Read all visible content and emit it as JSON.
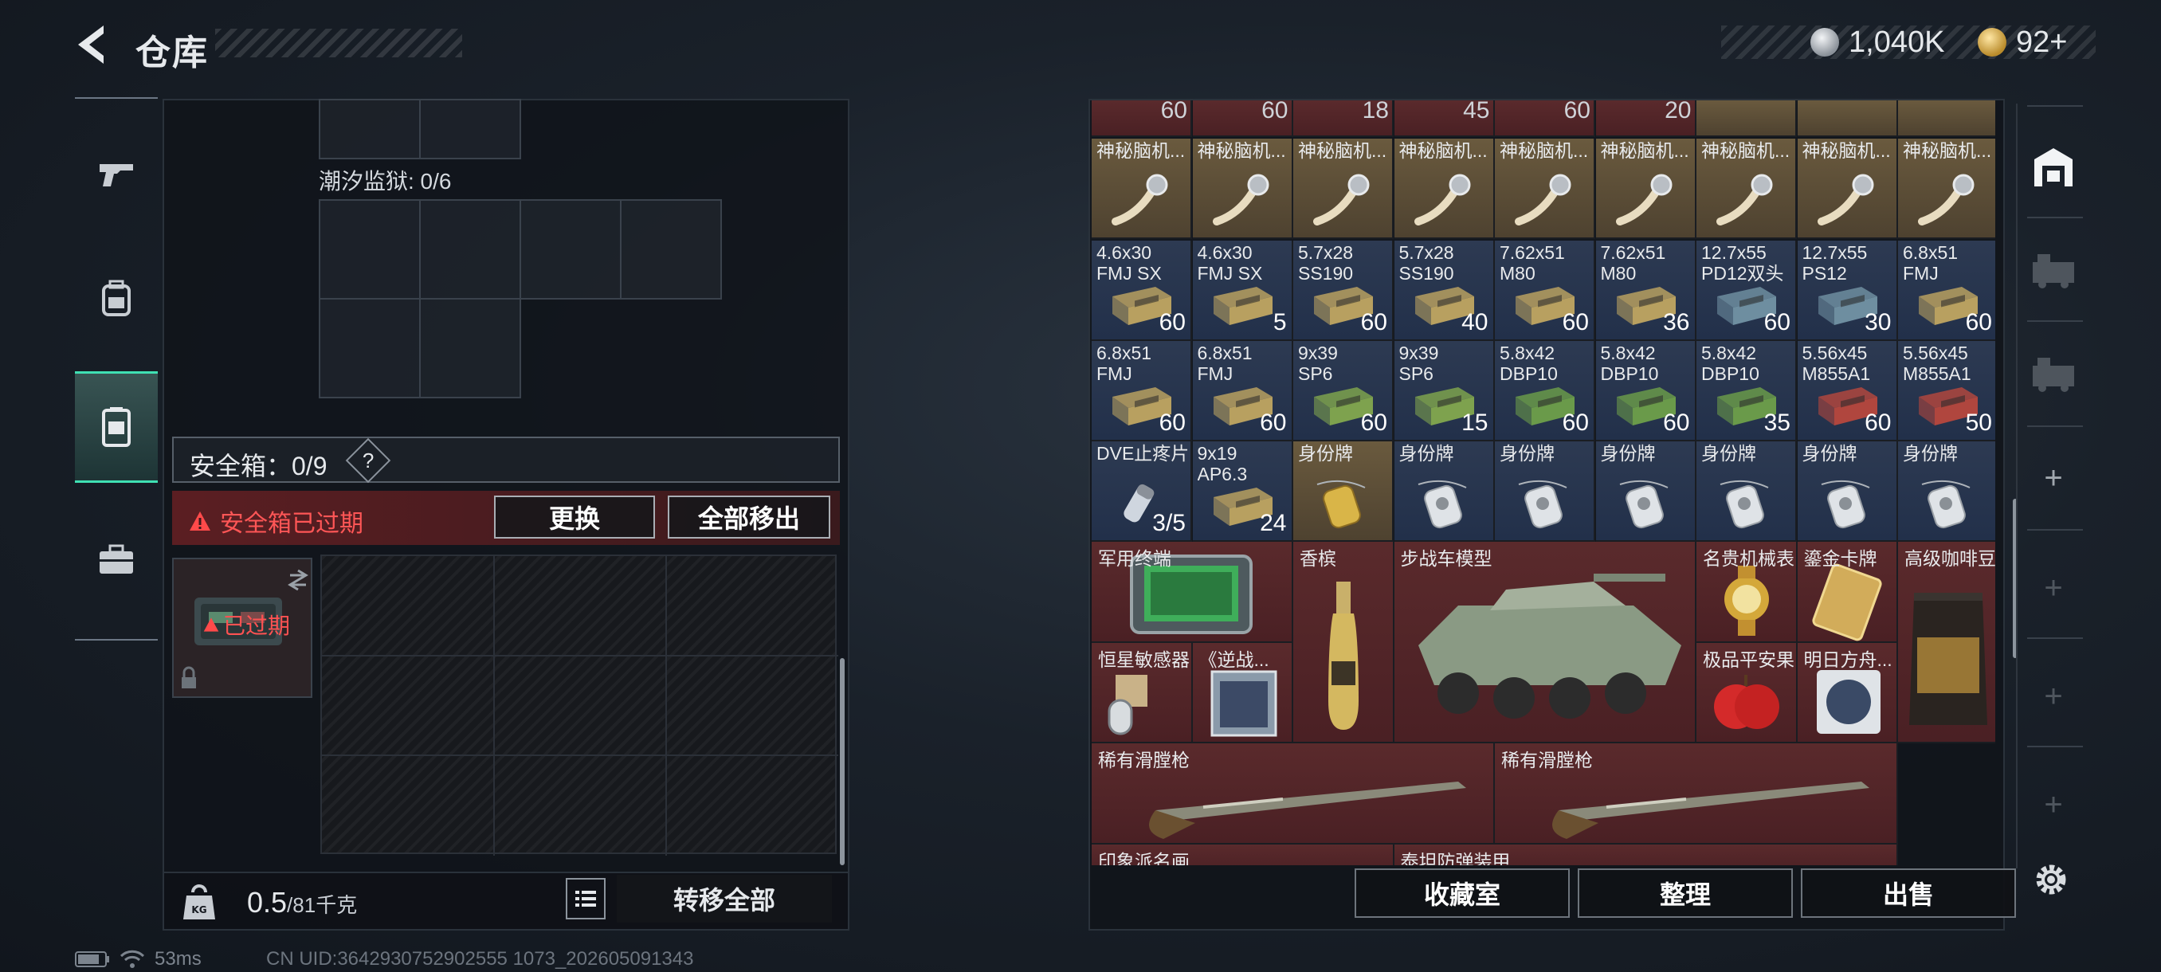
{
  "header": {
    "title": "仓库"
  },
  "currency": {
    "silver": "1,040K",
    "gold": "92+"
  },
  "left": {
    "prison_label": "潮汐监狱: 0/6",
    "safebox_label": "安全箱：0/9",
    "help": "?",
    "expired_warning": "安全箱已过期",
    "replace_btn": "更换",
    "remove_all_btn": "全部移出",
    "item_expired": "已过期",
    "weight_value": "0.5",
    "weight_max": "/81千克",
    "transfer_all": "转移全部"
  },
  "status": {
    "ping": "53ms",
    "uid": "CN UID:3642930752902555 1073_202605091343"
  },
  "inventory": {
    "top_qty": [
      "60",
      "60",
      "18",
      "45",
      "60",
      "20"
    ],
    "row1": [
      {
        "name": "神秘脑机...",
        "qty": ""
      },
      {
        "name": "神秘脑机...",
        "qty": ""
      },
      {
        "name": "神秘脑机...",
        "qty": ""
      },
      {
        "name": "神秘脑机...",
        "qty": ""
      },
      {
        "name": "神秘脑机...",
        "qty": ""
      },
      {
        "name": "神秘脑机...",
        "qty": ""
      },
      {
        "name": "神秘脑机...",
        "qty": ""
      },
      {
        "name": "神秘脑机...",
        "qty": ""
      },
      {
        "name": "神秘脑机...",
        "qty": ""
      }
    ],
    "row2": [
      {
        "name": "4.6x30",
        "sub": "FMJ SX",
        "qty": "60"
      },
      {
        "name": "4.6x30",
        "sub": "FMJ SX",
        "qty": "5"
      },
      {
        "name": "5.7x28",
        "sub": "SS190",
        "qty": "60"
      },
      {
        "name": "5.7x28",
        "sub": "SS190",
        "qty": "40"
      },
      {
        "name": "7.62x51",
        "sub": "M80",
        "qty": "60"
      },
      {
        "name": "7.62x51",
        "sub": "M80",
        "qty": "36"
      },
      {
        "name": "12.7x55",
        "sub": "PD12双头",
        "qty": "60"
      },
      {
        "name": "12.7x55",
        "sub": "PS12",
        "qty": "30"
      },
      {
        "name": "6.8x51",
        "sub": "FMJ",
        "qty": "60"
      }
    ],
    "row3": [
      {
        "name": "6.8x51",
        "sub": "FMJ",
        "qty": "60"
      },
      {
        "name": "6.8x51",
        "sub": "FMJ",
        "qty": "60"
      },
      {
        "name": "9x39",
        "sub": "SP6",
        "qty": "60"
      },
      {
        "name": "9x39",
        "sub": "SP6",
        "qty": "15"
      },
      {
        "name": "5.8x42",
        "sub": "DBP10",
        "qty": "60"
      },
      {
        "name": "5.8x42",
        "sub": "DBP10",
        "qty": "60"
      },
      {
        "name": "5.8x42",
        "sub": "DBP10",
        "qty": "35"
      },
      {
        "name": "5.56x45",
        "sub": "M855A1",
        "qty": "60"
      },
      {
        "name": "5.56x45",
        "sub": "M855A1",
        "qty": "50"
      }
    ],
    "row4": [
      {
        "name": "DVE止疼片",
        "qty": "3/5"
      },
      {
        "name": "9x19",
        "sub": "AP6.3",
        "qty": "24"
      },
      {
        "name": "身份牌",
        "qty": ""
      },
      {
        "name": "身份牌",
        "qty": ""
      },
      {
        "name": "身份牌",
        "qty": ""
      },
      {
        "name": "身份牌",
        "qty": ""
      },
      {
        "name": "身份牌",
        "qty": ""
      },
      {
        "name": "身份牌",
        "qty": ""
      },
      {
        "name": "身份牌",
        "qty": ""
      }
    ],
    "big_items": {
      "terminal": "军用终端",
      "champagne": "香槟",
      "ifv_model": "步战车模型",
      "watch": "名贵机械表",
      "gold_card": "鎏金卡牌",
      "coffee": "高级咖啡豆",
      "sensor": "恒星敏感器",
      "book": "《逆战...",
      "apple": "极品平安果",
      "album": "明日方舟...",
      "musket1": "稀有滑膛枪",
      "musket2": "稀有滑膛枪",
      "painting": "印象派名画",
      "armor": "泰坦防弹装甲"
    }
  },
  "actions": {
    "collection": "收藏室",
    "sort": "整理",
    "sell": "出售"
  },
  "icons": {
    "back": "back-arrow-icon",
    "weapon": "pistol-icon",
    "backpack": "backpack-icon",
    "safebox": "safebox-icon",
    "toolbox": "toolbox-icon",
    "storage": "storage-icon",
    "settings": "gear-icon"
  }
}
